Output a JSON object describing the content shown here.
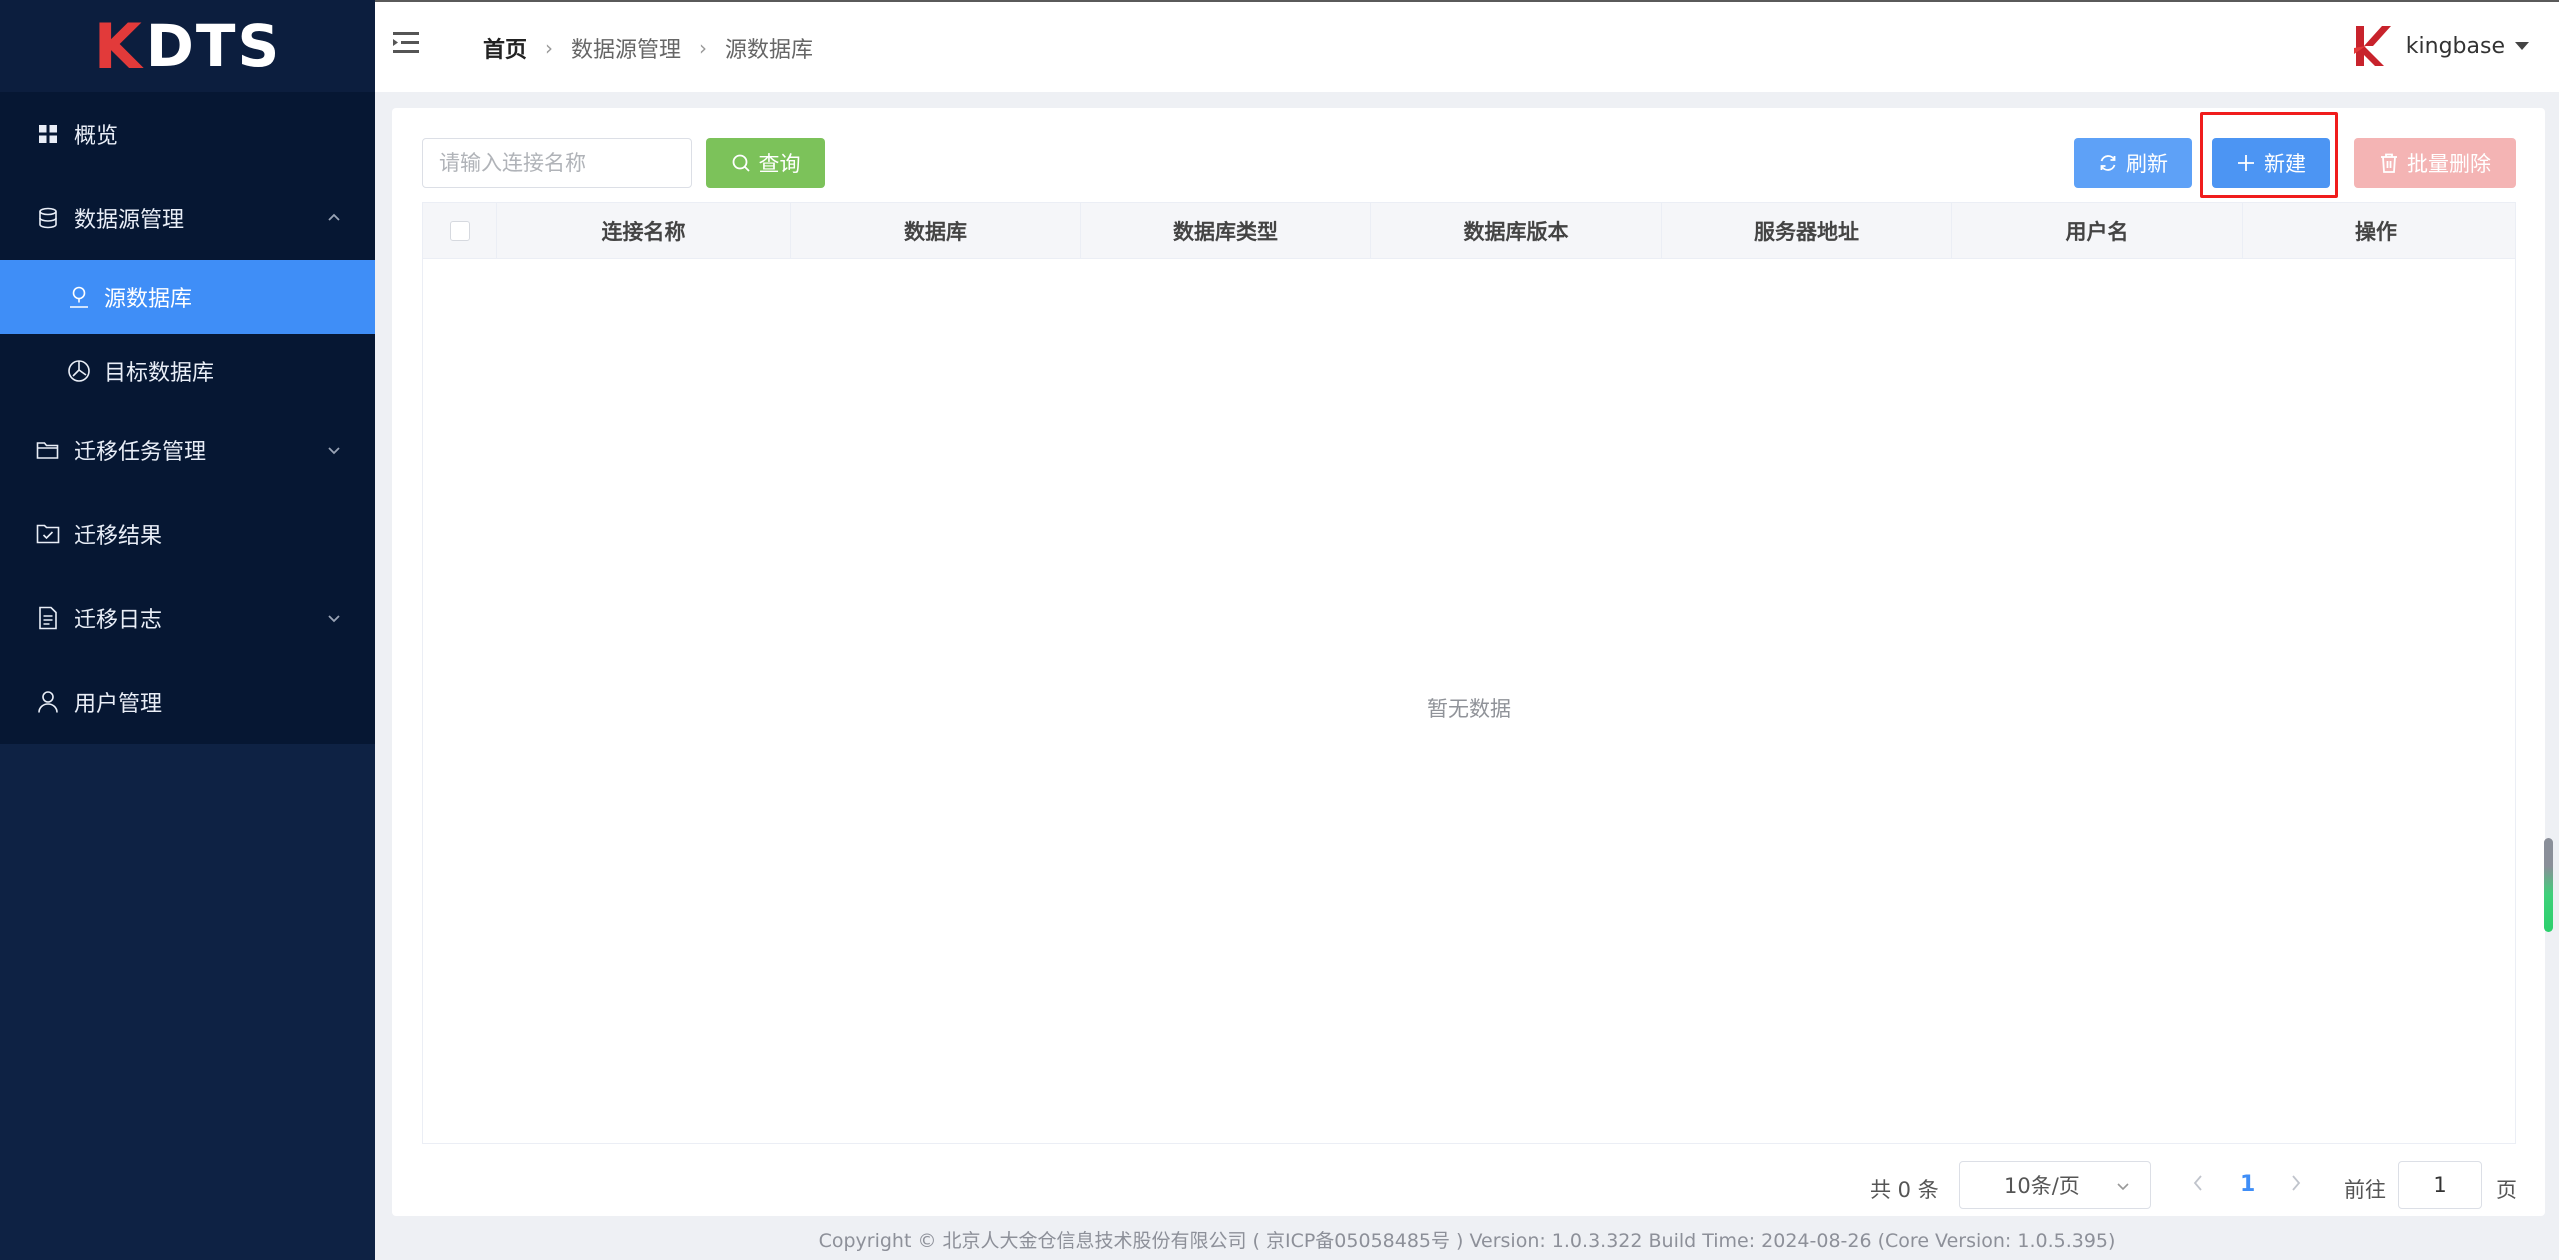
{
  "app": {
    "logo_k": "K",
    "logo_text": "DTS"
  },
  "sidebar": {
    "items": [
      {
        "label": "概览",
        "icon": "grid-icon"
      },
      {
        "label": "数据源管理",
        "icon": "database-icon",
        "expanded": true,
        "children": [
          {
            "label": "源数据库",
            "icon": "source-db-icon",
            "active": true
          },
          {
            "label": "目标数据库",
            "icon": "target-db-icon"
          }
        ]
      },
      {
        "label": "迁移任务管理",
        "icon": "folder-icon"
      },
      {
        "label": "迁移结果",
        "icon": "checklist-icon"
      },
      {
        "label": "迁移日志",
        "icon": "document-icon"
      },
      {
        "label": "用户管理",
        "icon": "user-icon"
      }
    ]
  },
  "header": {
    "breadcrumb": [
      "首页",
      "数据源管理",
      "源数据库"
    ],
    "username": "kingbase"
  },
  "toolbar": {
    "search_placeholder": "请输入连接名称",
    "search_value": "",
    "query_label": "查询",
    "refresh_label": "刷新",
    "new_label": "新建",
    "batch_delete_label": "批量删除"
  },
  "table": {
    "columns": [
      "连接名称",
      "数据库",
      "数据库类型",
      "数据库版本",
      "服务器地址",
      "用户名",
      "操作"
    ],
    "rows": [],
    "empty_text": "暂无数据"
  },
  "pagination": {
    "total_text": "共 0 条",
    "page_size": "10条/页",
    "current_page": "1",
    "goto_label": "前往",
    "goto_value": "1",
    "page_suffix": "页"
  },
  "footer": {
    "copyright": "Copyright © 北京人大金仓信息技术股份有限公司 ( 京ICP备05058485号 ) Version: 1.0.3.322 Build Time: 2024-08-26 (Core Version: 1.0.5.395)"
  },
  "colors": {
    "sidebar_bg": "#0e2244",
    "menu_bg": "#061733",
    "active_item": "#3f8ef7",
    "query_button": "#7cc25a",
    "primary_button": "#4c95f3",
    "danger_disabled": "#f4b4b4",
    "highlight": "#f01c1c"
  }
}
